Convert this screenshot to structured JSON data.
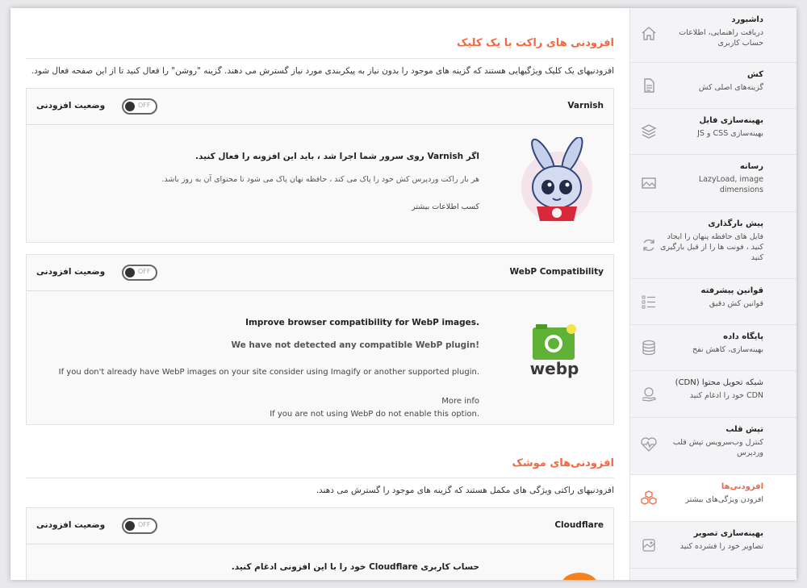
{
  "sections": [
    {
      "title": "افزودنی های راکت با یک کلیک",
      "description": "افزودنیهای یک کلیک ویژگیهایی هستند که گزینه های موجود را بدون نیاز به پیکربندی مورد نیاز گسترش می دهند. گزینه \"روشن\" را فعال کنید تا از این صفحه فعال شود."
    },
    {
      "title": "افزودنی‌های موشک",
      "description": "افزودنیهای راکتی ویژگی های مکمل هستند که گزینه های موجود را گسترش می دهند."
    }
  ],
  "addons": {
    "varnish": {
      "name": "Varnish",
      "status_label": "وضعیت افزودنی",
      "toggle": "OFF",
      "headline": "اگر Varnish روی سرور شما اجرا شد ، باید این افزونه را فعال کنید.",
      "body": "هر بار راکت وردپرس کش خود را پاک می کند ، حافظه نهان پاک می شود تا محتوای آن به روز باشد.",
      "more": "کسب اطلاعات بیشتر"
    },
    "webp": {
      "name": "WebP Compatibility",
      "status_label": "وضعیت افزودنی",
      "toggle": "OFF",
      "headline": "Improve browser compatibility for WebP images.",
      "warning": "We have not detected any compatible WebP plugin!",
      "body": "If you don't already have WebP images on your site consider using Imagify or another supported plugin.",
      "more": "More info",
      "note": "If you are not using WebP do not enable this option.",
      "logo_text": "webp"
    },
    "cloudflare": {
      "name": "Cloudflare",
      "status_label": "وضعیت افزودنی",
      "toggle": "OFF",
      "headline": "حساب کاربری Cloudflare خود را با این افزونی ادغام کنید."
    }
  },
  "sidebar": {
    "items": [
      {
        "title": "داشبورد",
        "sub": "دریافت راهنمایی، اطلاعات حساب کاربری",
        "icon": "home-icon"
      },
      {
        "title": "کش",
        "sub": "گزینه‌های اصلی کش",
        "icon": "file-icon"
      },
      {
        "title": "بهینه‌سازی فایل",
        "sub": "بهینه‌سازی CSS و JS",
        "icon": "layers-icon"
      },
      {
        "title": "رسانه",
        "sub": "LazyLoad, image dimensions",
        "icon": "image-icon"
      },
      {
        "title": "پیش بارگذاری",
        "sub": "فایل های حافظه پنهان را ایجاد کنید ، فونت ها را از قبل بارگیری کنید",
        "icon": "refresh-icon"
      },
      {
        "title": "قوانین پیشرفته",
        "sub": "قوانین کش دقیق",
        "icon": "list-icon"
      },
      {
        "title": "پایگاه داده",
        "sub": "بهینه‌سازی، کاهش نفخ",
        "icon": "database-icon"
      },
      {
        "title": "شبکه تحویل محتوا (CDN)",
        "sub": "CDN خود را ادغام کنید",
        "icon": "cdn-hand-icon"
      },
      {
        "title": "تپش قلب",
        "sub": "کنترل وب‌سرویس تپش قلب وردپرس",
        "icon": "heartbeat-icon"
      },
      {
        "title": "افزودنی‌ها",
        "sub": "افزودن ویژگی‌های بیشتر",
        "icon": "cubes-icon"
      },
      {
        "title": "بهینه‌سازی تصویر",
        "sub": "تصاویر خود را فشرده کنید",
        "icon": "image-compress-icon"
      }
    ]
  },
  "colors": {
    "accent": "#f56640",
    "webp_green": "#5fb236",
    "cloudflare_orange": "#f48120"
  }
}
